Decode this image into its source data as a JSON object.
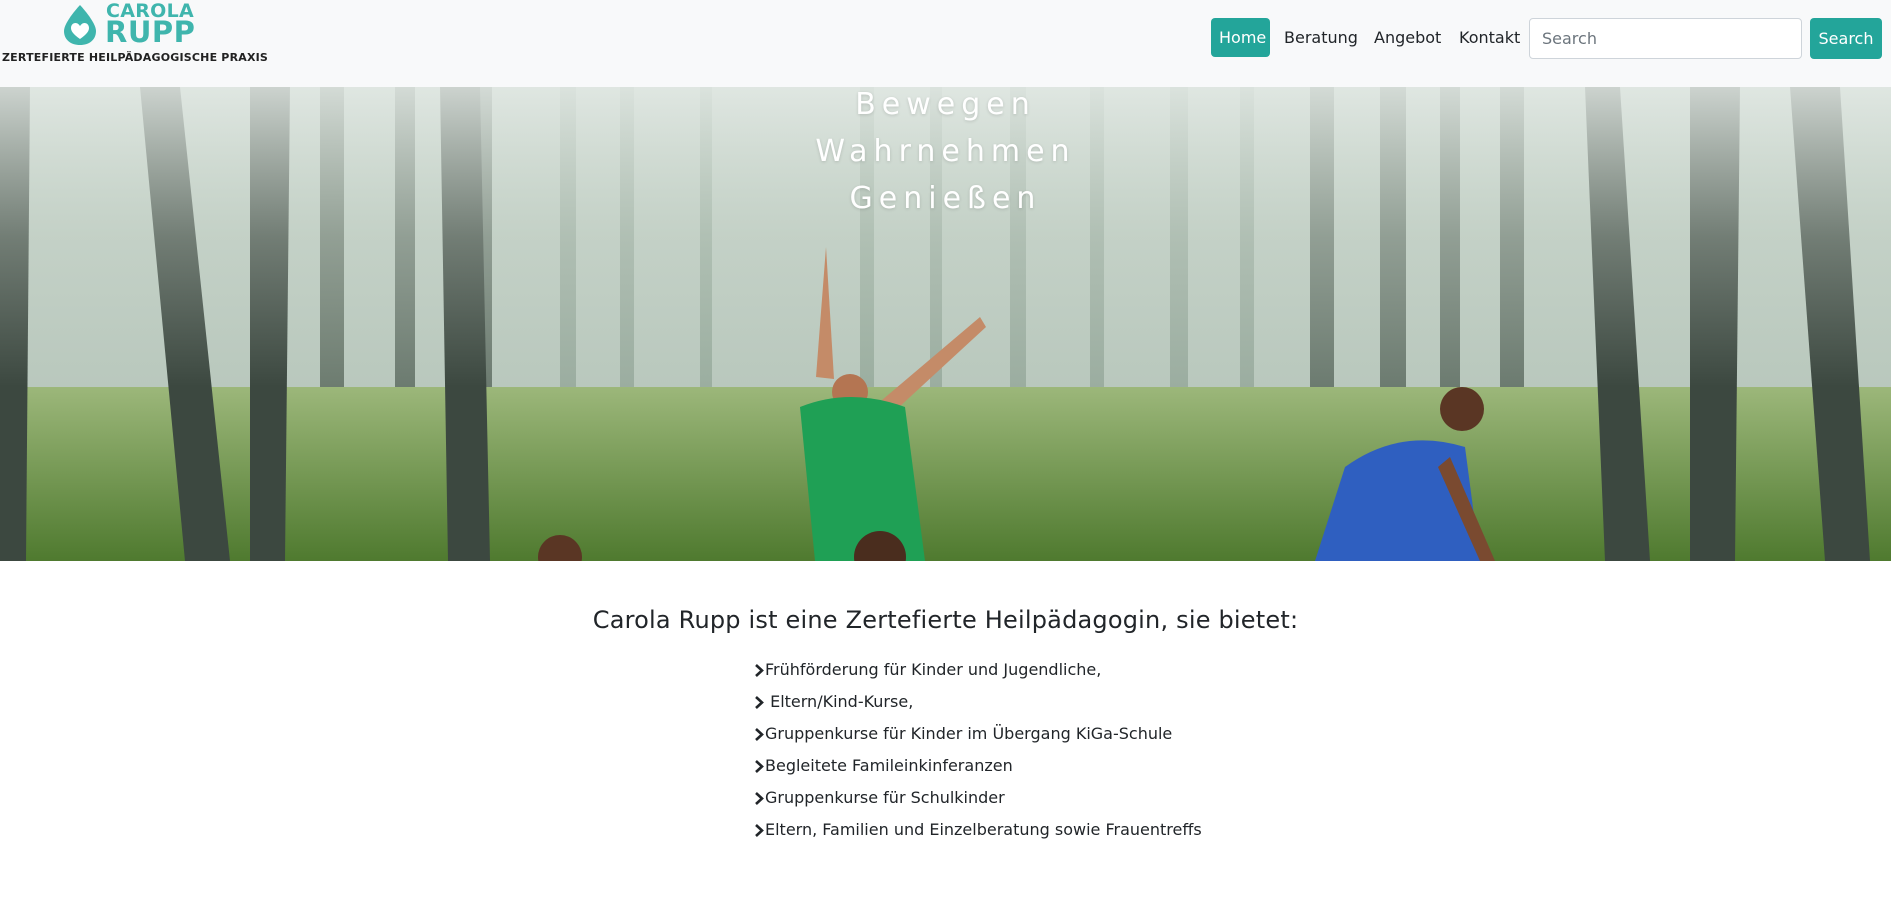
{
  "brand": {
    "name_line1": "CAROLA",
    "name_line2": "RUPP",
    "subtitle": "ZERTEFIERTE HEILPÄDAGOGISCHE PRAXIS",
    "color": "#3fb5ad"
  },
  "nav": {
    "items": [
      {
        "label": "Home",
        "active": true
      },
      {
        "label": "Beratung",
        "active": false
      },
      {
        "label": "Angebot",
        "active": false
      },
      {
        "label": "Kontakt",
        "active": false
      }
    ],
    "search_placeholder": "Search",
    "search_button": "Search",
    "accent": "#23a59a"
  },
  "hero": {
    "lines": [
      "Bewegen",
      "Wahrnehmen",
      "Genießen"
    ]
  },
  "content": {
    "title": "Carola Rupp ist eine Zertefierte Heilpädagogin, sie bietet:",
    "items": [
      "Frühförderung für Kinder und Jugendliche,",
      " Eltern/Kind-Kurse,",
      "Gruppenkurse für Kinder im Übergang KiGa-Schule",
      "Begleitete Famileinkinferanzen",
      "Gruppenkurse für Schulkinder",
      "Eltern, Familien und Einzelberatung sowie Frauentreffs"
    ],
    "bullet_icon": "chevron-right-icon"
  }
}
